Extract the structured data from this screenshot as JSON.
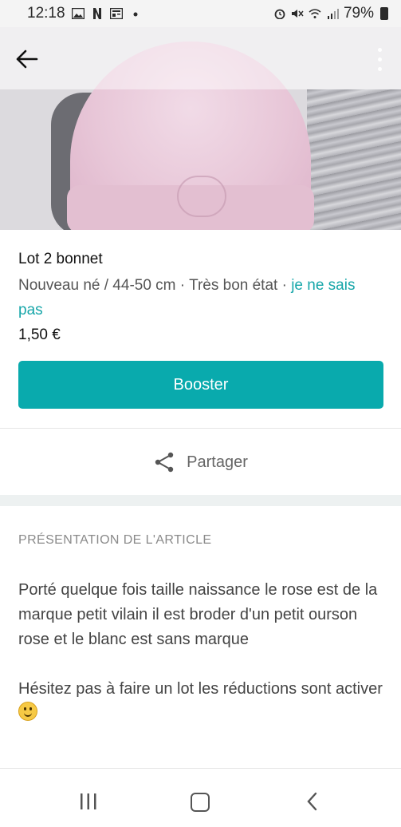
{
  "status_bar": {
    "time": "12:18",
    "battery": "79%"
  },
  "listing": {
    "title": "Lot 2 bonnet",
    "size": "Nouveau né / 44-50 cm",
    "separator": " · ",
    "condition": "Très bon état",
    "brand_link": "je ne sais pas",
    "price": "1,50 €"
  },
  "actions": {
    "booster_label": "Booster",
    "share_label": "Partager"
  },
  "description": {
    "section_title": "PRÉSENTATION DE L'ARTICLE",
    "paragraph_1": "Porté quelque fois taille naissance le rose est de la marque petit vilain il est broder d'un petit ourson rose et le blanc est sans marque",
    "paragraph_2": "Hésitez pas à faire un lot les réductions sont activer"
  },
  "icons": {
    "back": "arrow-left-icon",
    "more": "more-vert-icon",
    "share": "share-icon",
    "smiley": "smiley-emoji"
  },
  "colors": {
    "accent": "#09aaad",
    "link": "#17a6a9"
  }
}
